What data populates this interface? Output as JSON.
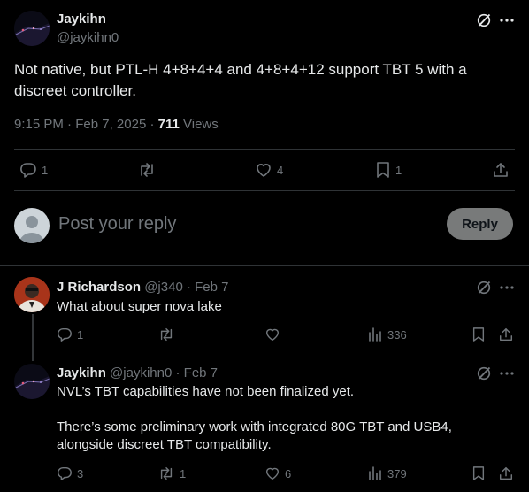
{
  "main_post": {
    "author_name": "Jaykihn",
    "author_handle": "@jaykihn0",
    "text": "Not native, but PTL-H 4+8+4+4 and 4+8+4+12 support TBT 5 with a discreet controller.",
    "time": "9:15 PM",
    "date": "Feb 7, 2025",
    "views_count": "711",
    "views_label": "Views",
    "replies": "1",
    "reposts": "",
    "likes": "4",
    "bookmarks": "1"
  },
  "reply_box": {
    "placeholder": "Post your reply",
    "button_label": "Reply"
  },
  "replies": [
    {
      "author_name": "J Richardson",
      "author_handle": "@j340",
      "date": "Feb 7",
      "text": "What about super nova lake",
      "replies": "1",
      "reposts": "",
      "likes": "",
      "views": "336"
    },
    {
      "author_name": "Jaykihn",
      "author_handle": "@jaykihn0",
      "date": "Feb 7",
      "text_p1": "NVL’s TBT capabilities have not been finalized yet.",
      "text_p2": "There’s some preliminary work with integrated 80G TBT and USB4, alongside discreet TBT compatibility.",
      "replies": "3",
      "reposts": "1",
      "likes": "6",
      "views": "379"
    }
  ],
  "colors": {
    "background": "#000000",
    "text": "#e7e9ea",
    "muted": "#71767b",
    "divider": "#2f3336",
    "reply_button_bg": "#787a7a"
  },
  "icons": [
    "grok-icon",
    "more-icon",
    "reply-icon",
    "repost-icon",
    "like-icon",
    "bookmark-icon",
    "share-icon",
    "views-icon"
  ]
}
